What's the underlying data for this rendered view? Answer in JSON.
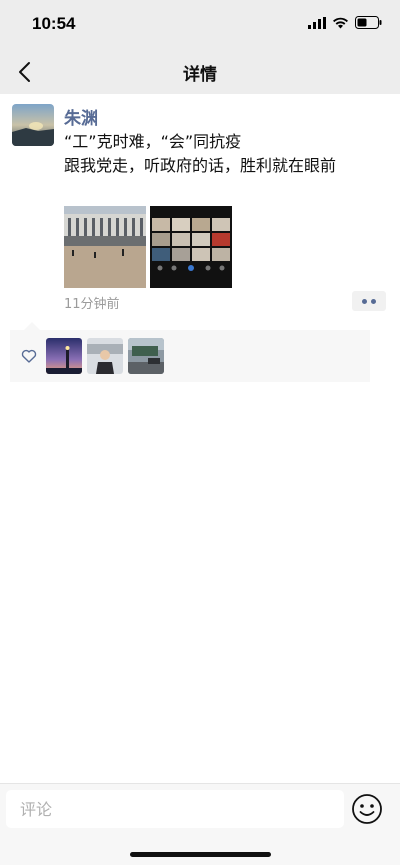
{
  "status_bar": {
    "time": "10:54"
  },
  "nav": {
    "title": "详情"
  },
  "post": {
    "author": "朱渊",
    "content_line1": "“工”克时难，“会”同抗疫",
    "content_line2": "跟我党走，听政府的话，胜利就在眼前",
    "time_ago": "11分钟前",
    "photos": [
      {
        "alt": "building-plaza-photo"
      },
      {
        "alt": "video-conference-photo"
      }
    ]
  },
  "likes": {
    "likers": [
      {
        "alt": "lighthouse-avatar"
      },
      {
        "alt": "person-avatar"
      },
      {
        "alt": "street-avatar"
      }
    ]
  },
  "comment": {
    "placeholder": "评论"
  },
  "colors": {
    "link": "#576b95",
    "nav_bg": "#ededed",
    "time": "#9b9b9b"
  }
}
